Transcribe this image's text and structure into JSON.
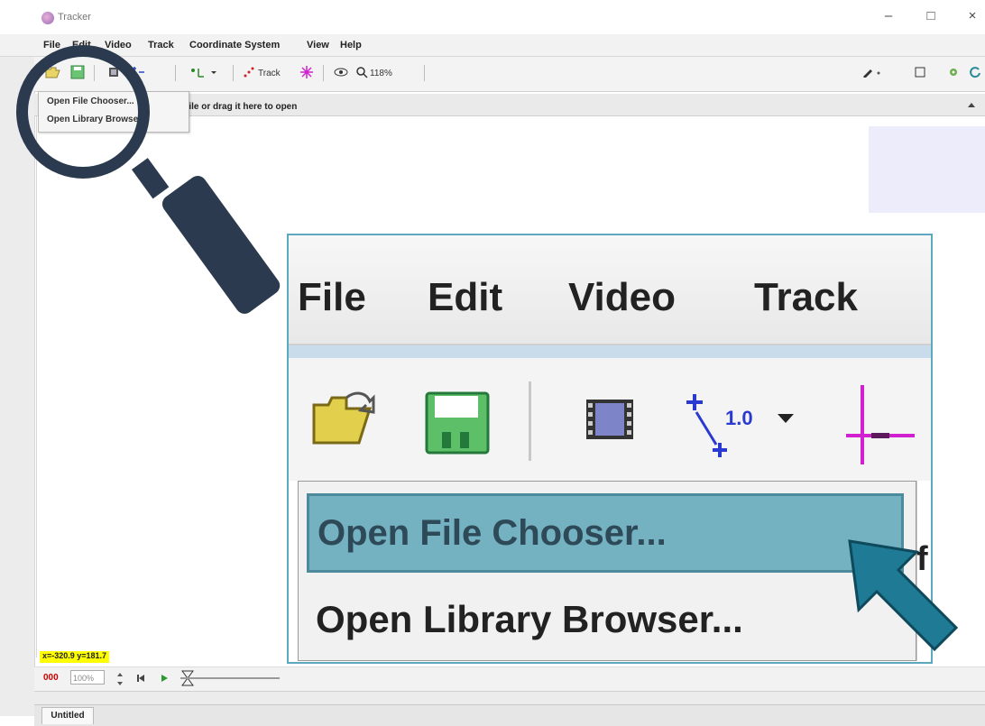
{
  "window": {
    "title": "Tracker",
    "controls": [
      "–",
      "□",
      "×"
    ]
  },
  "menubar": [
    "File",
    "Edit",
    "Video",
    "Track",
    "Coordinate System",
    "View",
    "Help"
  ],
  "toolbar": {
    "track_label": "Track",
    "zoom_label": "118%",
    "icons": [
      "open-icon",
      "save-icon",
      "clip-icon",
      "axes-icon",
      "calibration-icon",
      "track-icon",
      "eye-icon",
      "zoom-icon",
      "pencil-icon",
      "window-icon",
      "gear-icon",
      "refresh-icon"
    ]
  },
  "info_text": "file or drag it here to open",
  "small_menu": {
    "items": [
      "Open File Chooser...",
      "Open Library Browser..."
    ]
  },
  "zoom_callout": {
    "menus": [
      "File",
      "Edit",
      "Video",
      "Track"
    ],
    "calibration_label": "1.0",
    "items": [
      "Open File Chooser...",
      "Open Library Browser..."
    ],
    "partial_text": "f"
  },
  "bottom": {
    "coord_text": "x=-320.9  y=181.7",
    "rate_text": "000",
    "percent_text": "100%",
    "tab_label": "Untitled"
  },
  "colors": {
    "magnifier": "#2b3a4e",
    "callout_border": "#5ea8bf",
    "highlight": "#74b1c1",
    "arrow": "#1f7a96"
  }
}
